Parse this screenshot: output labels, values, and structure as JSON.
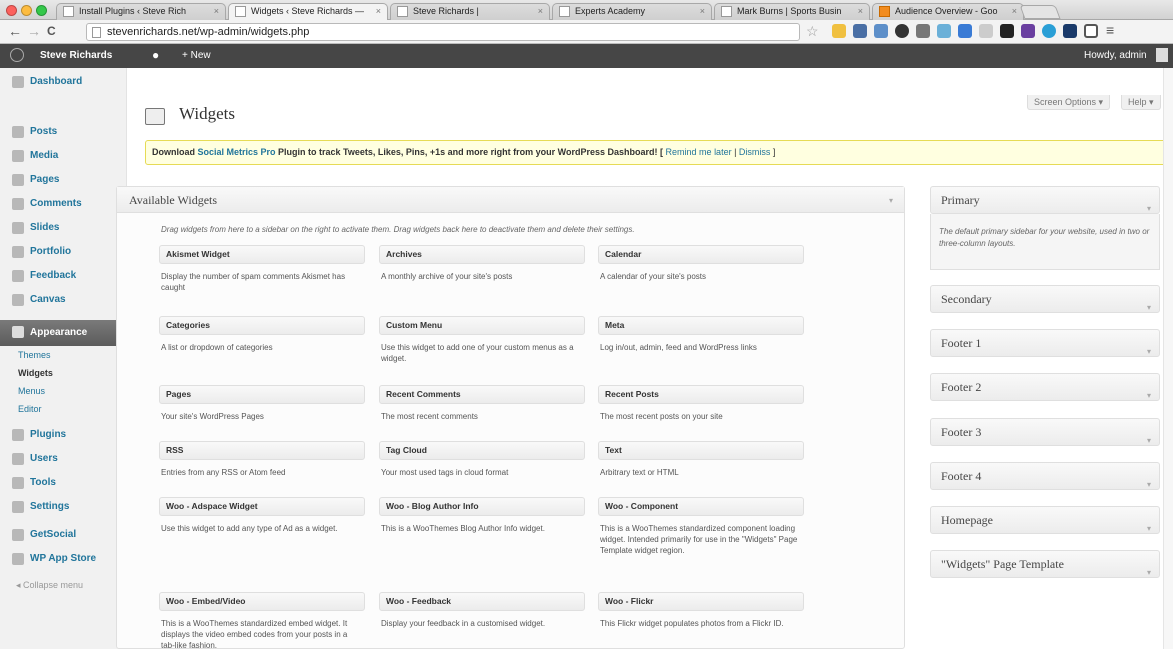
{
  "browser": {
    "tabs": [
      {
        "title": "Install Plugins ‹ Steve Rich",
        "active": false
      },
      {
        "title": "Widgets ‹ Steve Richards —",
        "active": true
      },
      {
        "title": "Steve Richards |",
        "active": false
      },
      {
        "title": "Experts Academy",
        "active": false
      },
      {
        "title": "Mark Burns | Sports Busin",
        "active": false
      },
      {
        "title": "Audience Overview - Goo",
        "active": false
      }
    ],
    "close_glyph": "×",
    "url": "stevenrichards.net/wp-admin/widgets.php",
    "back_glyph": "←",
    "forward_glyph": "→",
    "reload_glyph": "C"
  },
  "adminbar": {
    "site_name": "Steve Richards",
    "new_label": "+ New",
    "howdy": "Howdy, admin"
  },
  "sidebar": {
    "items": [
      {
        "label": "Dashboard",
        "icon": "dashboard-icon"
      },
      {
        "label": "Posts",
        "icon": "posts-icon"
      },
      {
        "label": "Media",
        "icon": "media-icon"
      },
      {
        "label": "Pages",
        "icon": "pages-icon"
      },
      {
        "label": "Comments",
        "icon": "comments-icon"
      },
      {
        "label": "Slides",
        "icon": "slides-icon"
      },
      {
        "label": "Portfolio",
        "icon": "portfolio-icon"
      },
      {
        "label": "Feedback",
        "icon": "feedback-icon"
      },
      {
        "label": "Canvas",
        "icon": "canvas-icon"
      },
      {
        "label": "Appearance",
        "icon": "appearance-icon",
        "current": true
      },
      {
        "label": "Plugins",
        "icon": "plugins-icon"
      },
      {
        "label": "Users",
        "icon": "users-icon"
      },
      {
        "label": "Tools",
        "icon": "tools-icon"
      },
      {
        "label": "Settings",
        "icon": "settings-icon"
      },
      {
        "label": "GetSocial",
        "icon": "getsocial-icon"
      },
      {
        "label": "WP App Store",
        "icon": "app-store-icon"
      }
    ],
    "submenu": [
      {
        "label": "Themes",
        "current": false
      },
      {
        "label": "Widgets",
        "current": true
      },
      {
        "label": "Menus",
        "current": false
      },
      {
        "label": "Editor",
        "current": false
      }
    ],
    "collapse": "Collapse menu"
  },
  "main": {
    "title": "Widgets",
    "screen_options": "Screen Options ▾",
    "help": "Help ▾",
    "notice": {
      "prefix": "Download ",
      "link": "Social Metrics Pro",
      "middle": " Plugin to track Tweets, Likes, Pins, +1s and more right from your WordPress Dashboard! [ ",
      "remind": "Remind me later",
      "sep": " | ",
      "dismiss": "Dismiss",
      "suffix": " ]"
    },
    "available": {
      "title": "Available Widgets",
      "description": "Drag widgets from here to a sidebar on the right to activate them. Drag widgets back here to deactivate them and delete their settings.",
      "widgets": [
        {
          "name": "Akismet Widget",
          "desc": "Display the number of spam comments Akismet has caught"
        },
        {
          "name": "Archives",
          "desc": "A monthly archive of your site's posts"
        },
        {
          "name": "Calendar",
          "desc": "A calendar of your site's posts"
        },
        {
          "name": "Categories",
          "desc": "A list or dropdown of categories"
        },
        {
          "name": "Custom Menu",
          "desc": "Use this widget to add one of your custom menus as a widget."
        },
        {
          "name": "Meta",
          "desc": "Log in/out, admin, feed and WordPress links"
        },
        {
          "name": "Pages",
          "desc": "Your site's WordPress Pages"
        },
        {
          "name": "Recent Comments",
          "desc": "The most recent comments"
        },
        {
          "name": "Recent Posts",
          "desc": "The most recent posts on your site"
        },
        {
          "name": "RSS",
          "desc": "Entries from any RSS or Atom feed"
        },
        {
          "name": "Tag Cloud",
          "desc": "Your most used tags in cloud format"
        },
        {
          "name": "Text",
          "desc": "Arbitrary text or HTML"
        },
        {
          "name": "Woo - Adspace Widget",
          "desc": "Use this widget to add any type of Ad as a widget."
        },
        {
          "name": "Woo - Blog Author Info",
          "desc": "This is a WooThemes Blog Author Info widget."
        },
        {
          "name": "Woo - Component",
          "desc": "This is a WooThemes standardized component loading widget. Intended primarily for use in the \"Widgets\" Page Template widget region."
        },
        {
          "name": "Woo - Embed/Video",
          "desc": "This is a WooThemes standardized embed widget. It displays the video embed codes from your posts in a tab-like fashion."
        },
        {
          "name": "Woo - Feedback",
          "desc": "Display your feedback in a customised widget."
        },
        {
          "name": "Woo - Flickr",
          "desc": "This Flickr widget populates photos from a Flickr ID."
        }
      ]
    },
    "sidebars": [
      {
        "name": "Primary",
        "open": true,
        "desc": "The default primary sidebar for your website, used in two or three-column layouts."
      },
      {
        "name": "Secondary"
      },
      {
        "name": "Footer 1"
      },
      {
        "name": "Footer 2"
      },
      {
        "name": "Footer 3"
      },
      {
        "name": "Footer 4"
      },
      {
        "name": "Homepage"
      },
      {
        "name": "\"Widgets\" Page Template"
      }
    ],
    "toggle_glyph": "▾"
  }
}
